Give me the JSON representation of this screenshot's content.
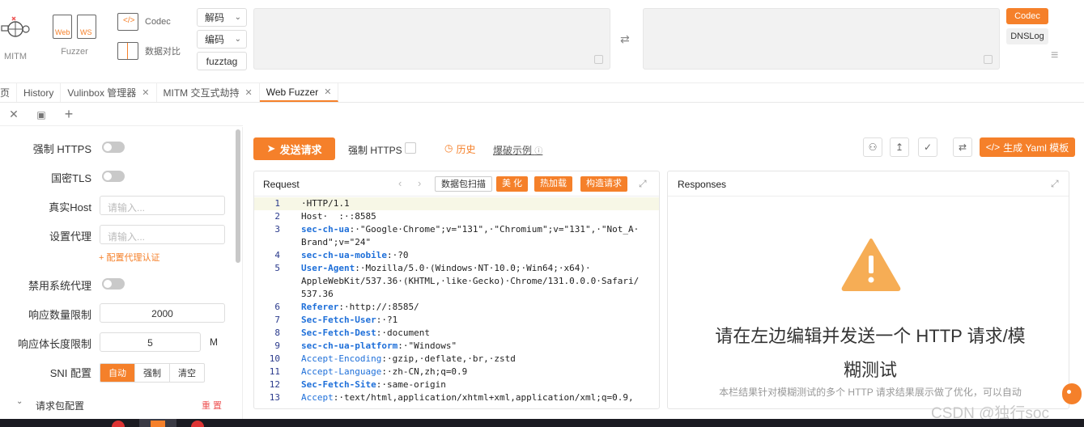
{
  "toolbar": {
    "mitm_label": "MITM",
    "fuzzer_label": "Fuzzer",
    "web_label": "Web",
    "ws_label": "WS",
    "codec_label": "Codec",
    "compare_label": "数据对比",
    "decode_select": "解码",
    "encode_select": "编码",
    "fuzztag_button": "fuzztag",
    "codec_tag": "Codec",
    "dnslog_tag": "DNSLog"
  },
  "tabs": [
    {
      "label": "页",
      "closable": false
    },
    {
      "label": "History",
      "closable": false
    },
    {
      "label": "Vulinbox 管理器",
      "closable": true
    },
    {
      "label": "MITM 交互式劫持",
      "closable": true
    },
    {
      "label": "Web Fuzzer",
      "closable": true,
      "active": true
    }
  ],
  "left": {
    "force_https_label": "强制 HTTPS",
    "gm_tls_label": "国密TLS",
    "real_host_label": "真实Host",
    "real_host_placeholder": "请输入...",
    "proxy_label": "设置代理",
    "proxy_placeholder": "请输入...",
    "proxy_auth_link": "+ 配置代理认证",
    "disable_sys_proxy_label": "禁用系统代理",
    "resp_count_label": "响应数量限制",
    "resp_count_value": "2000",
    "resp_size_label": "响应体长度限制",
    "resp_size_value": "5",
    "resp_size_unit": "M",
    "sni_label": "SNI 配置",
    "sni_options": [
      "自动",
      "强制",
      "清空"
    ],
    "sni_selected": "自动",
    "packet_config_label": "请求包配置",
    "reset_label": "重 置"
  },
  "actions": {
    "send_button": "发送请求",
    "force_https_label": "强制 HTTPS",
    "history_label": "历史",
    "examples_label": "爆破示例",
    "yaml_button": "生成 Yaml 模板"
  },
  "request": {
    "title": "Request",
    "scan_button": "数据包扫描",
    "beautify_button": "美 化",
    "hot_patch_button": "热加载",
    "build_button": "构造请求",
    "lines": [
      {
        "n": "1",
        "key": "",
        "val": "·HTTP/1.1"
      },
      {
        "n": "2",
        "key": "",
        "val": "Host·  :·:8585"
      },
      {
        "n": "3",
        "key": "sec-ch-ua",
        "val": ":·\"Google·Chrome\";v=\"131\",·\"Chromium\";v=\"131\",·\"Not_A·"
      },
      {
        "n": "",
        "key": "",
        "val": "Brand\";v=\"24\""
      },
      {
        "n": "4",
        "key": "sec-ch-ua-mobile",
        "val": ":·?0"
      },
      {
        "n": "5",
        "key": "User-Agent",
        "val": ":·Mozilla/5.0·(Windows·NT·10.0;·Win64;·x64)·"
      },
      {
        "n": "",
        "key": "",
        "val": "AppleWebKit/537.36·(KHTML,·like·Gecko)·Chrome/131.0.0.0·Safari/"
      },
      {
        "n": "",
        "key": "",
        "val": "537.36"
      },
      {
        "n": "6",
        "key": "Referer",
        "val": ":·http://:8585/"
      },
      {
        "n": "7",
        "key": "Sec-Fetch-User",
        "val": ":·?1"
      },
      {
        "n": "8",
        "key": "Sec-Fetch-Dest",
        "val": ":·document"
      },
      {
        "n": "9",
        "key": "sec-ch-ua-platform",
        "val": ":·\"Windows\""
      },
      {
        "n": "10",
        "key": "Accept-Encoding",
        "val": ":·gzip,·deflate,·br,·zstd"
      },
      {
        "n": "11",
        "key": "Accept-Language",
        "val": ":·zh-CN,zh;q=0.9"
      },
      {
        "n": "12",
        "key": "Sec-Fetch-Site",
        "val": ":·same-origin"
      },
      {
        "n": "13",
        "key": "Accept",
        "val": ":·text/html,application/xhtml+xml,application/xml;q=0.9,"
      }
    ]
  },
  "response": {
    "title": "Responses",
    "empty_title_line1": "请在左边编辑并发送一个 HTTP 请求/模",
    "empty_title_line2": "糊测试",
    "empty_desc": "本栏结果针对模糊测试的多个 HTTP 请求结果展示做了优化，可以自动"
  },
  "watermark": "CSDN @独行soc",
  "colors": {
    "accent": "#f5802a",
    "warning": "#f6ad55",
    "key_blue": "#1e6fd9"
  }
}
